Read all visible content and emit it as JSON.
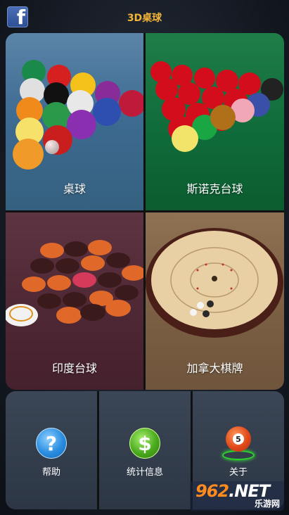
{
  "app": {
    "title": "3D桌球",
    "facebook_glyph": "f"
  },
  "games": [
    {
      "label": "桌球"
    },
    {
      "label": "斯诺克台球"
    },
    {
      "label": "印度台球"
    },
    {
      "label": "加拿大棋牌"
    }
  ],
  "actions": [
    {
      "label": "帮助",
      "icon": "help-icon",
      "glyph": "?"
    },
    {
      "label": "统计信息",
      "icon": "stats-icon",
      "glyph": "$"
    },
    {
      "label": "关于",
      "icon": "about-icon",
      "glyph": "5"
    }
  ],
  "watermark": {
    "number": "962",
    "suffix": ".NET",
    "sub": "乐游网"
  },
  "colors": {
    "title": "#f2b43a",
    "pool_tile": "#3d6a90",
    "snooker_tile": "#0f6a39",
    "carrom_tile": "#4d2733",
    "crokinole_tile": "#7a5e43"
  }
}
